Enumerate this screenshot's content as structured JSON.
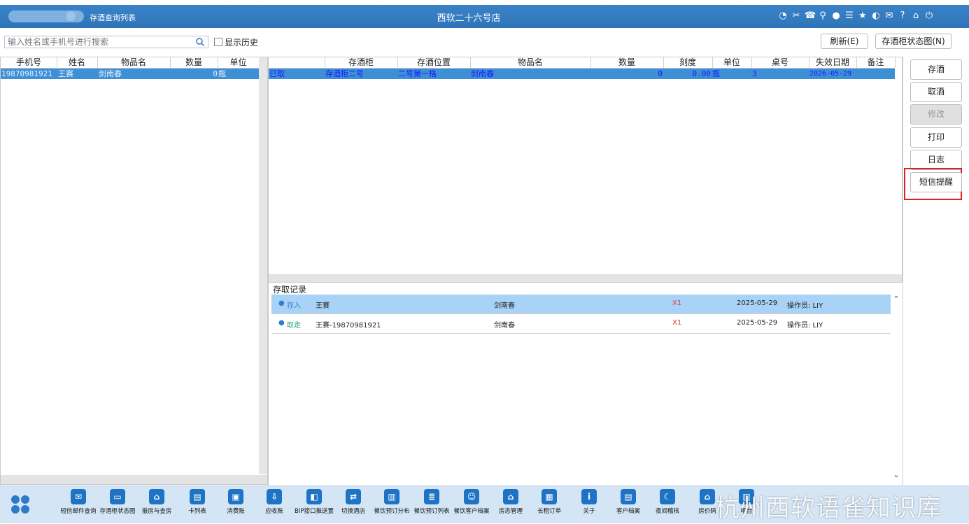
{
  "titlebar": {
    "tab_label": "存酒查询列表",
    "title": "西软二十六号店",
    "icons": [
      "wifi-icon",
      "tools-icon",
      "phone-icon",
      "location-icon",
      "palette-icon",
      "menu-icon",
      "star-icon",
      "contrast-icon",
      "mail-icon",
      "help-icon",
      "home-icon",
      "power-icon"
    ]
  },
  "toolbar": {
    "search_placeholder": "输入姓名或手机号进行搜索",
    "show_history_label": "显示历史",
    "refresh_label": "刷新(E)",
    "cabinet_status_label": "存酒柜状态图(N)"
  },
  "left_table": {
    "columns": [
      "手机号",
      "姓名",
      "物品名",
      "数量",
      "单位"
    ],
    "rows": [
      {
        "phone": "19870981921",
        "name": "王赛",
        "item": "剑南春",
        "qty": "0",
        "unit": "瓶"
      }
    ]
  },
  "right_table": {
    "columns": [
      "",
      "存酒柜",
      "存酒位置",
      "物品名",
      "数量",
      "刻度",
      "单位",
      "桌号",
      "失效日期",
      "备注"
    ],
    "rows": [
      {
        "status": "已取",
        "cabinet": "存酒柜二号",
        "position": "二号第一格",
        "item": "剑南春",
        "qty": "0",
        "scale": "0.00",
        "unit": "瓶",
        "table": "3",
        "expiry": "2026-05-29",
        "note": ""
      }
    ]
  },
  "records": {
    "title": "存取记录",
    "items": [
      {
        "action": "存入",
        "person": "王赛",
        "item": "剑南春",
        "count": "X1",
        "date": "2025-05-29",
        "operator": "操作员: LIY"
      },
      {
        "action": "取走",
        "person": "王赛-19870981921",
        "item": "剑南春",
        "count": "X1",
        "date": "2025-05-29",
        "operator": "操作员: LIY"
      }
    ]
  },
  "side_buttons": {
    "deposit": "存酒",
    "withdraw": "取酒",
    "modify": "修改",
    "print": "打印",
    "log": "日志",
    "sms": "短信提醒"
  },
  "bottom_bar": {
    "items": [
      "短信邮件查询",
      "存酒柜状态图",
      "报房与查房",
      "卡列表",
      "消费账",
      "应收账",
      "BIP接口推送置",
      "切换酒店",
      "餐饮预订分布",
      "餐饮预订列表",
      "餐饮客户档案",
      "房态管理",
      "长租订单",
      "关于",
      "客户档案",
      "夜间稽核",
      "房价码",
      "吧台"
    ]
  },
  "watermark": "杭州西软语雀知识库",
  "colors": {
    "titlebar": "#2f74b8",
    "selected_row": "#3d8fd6",
    "record_highlight": "#a9d3f6",
    "highlight_border": "#e02020",
    "bottombar": "#d4e6f6"
  }
}
